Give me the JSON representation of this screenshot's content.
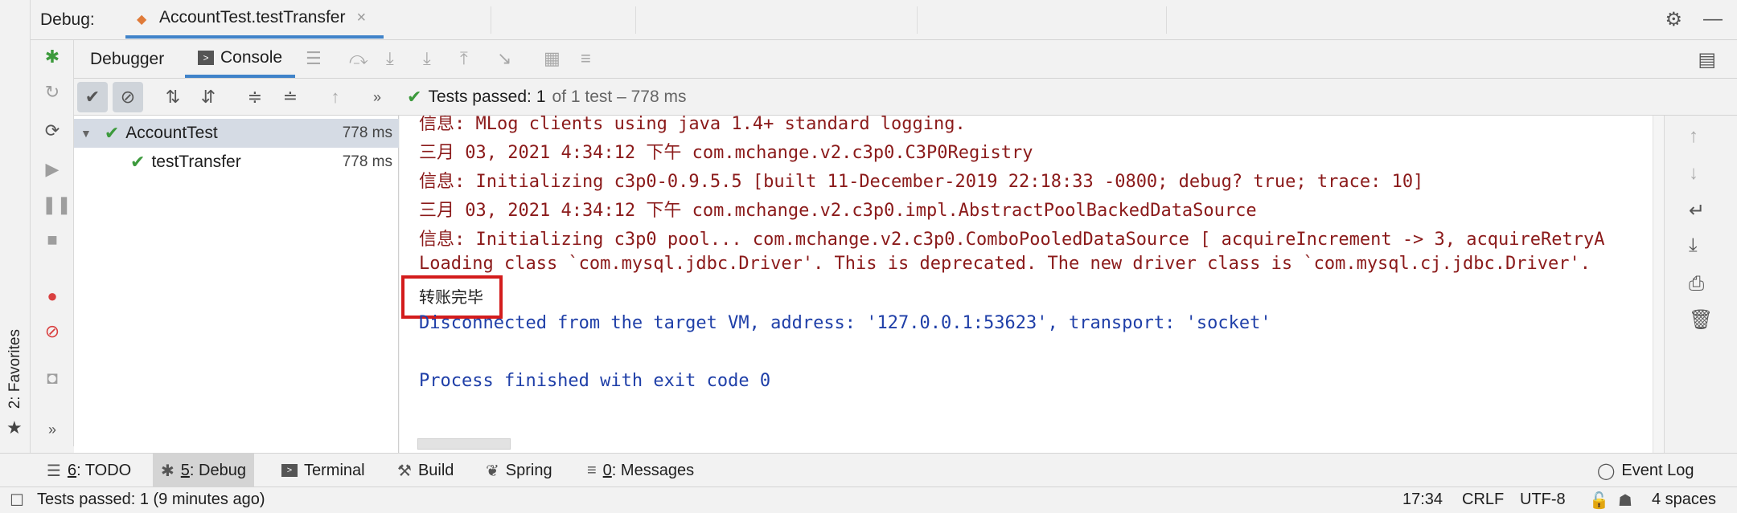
{
  "favorites": {
    "label": "2: Favorites"
  },
  "titlebar": {
    "debug_label": "Debug:",
    "tab_title": "AccountTest.testTransfer"
  },
  "subtabs": {
    "debugger": "Debugger",
    "console": "Console"
  },
  "testbar": {
    "passed_label": "Tests passed:",
    "passed_count": "1",
    "passed_detail": "of 1 test – 778 ms"
  },
  "tree": {
    "items": [
      {
        "name": "AccountTest",
        "time": "778 ms"
      },
      {
        "name": "testTransfer",
        "time": "778 ms"
      }
    ]
  },
  "console": {
    "lines": [
      "信息: MLog clients using java 1.4+ standard logging.",
      "三月 03, 2021 4:34:12 下午 com.mchange.v2.c3p0.C3P0Registry",
      "信息: Initializing c3p0-0.9.5.5 [built 11-December-2019 22:18:33 -0800; debug? true; trace: 10]",
      "三月 03, 2021 4:34:12 下午 com.mchange.v2.c3p0.impl.AbstractPoolBackedDataSource",
      "信息: Initializing c3p0 pool... com.mchange.v2.c3p0.ComboPooledDataSource [ acquireIncrement -> 3, acquireRetryA",
      "Loading class `com.mysql.jdbc.Driver'. This is deprecated. The new driver class is `com.mysql.cj.jdbc.Driver'.",
      "转账完毕",
      "Disconnected from the target VM, address: '127.0.0.1:53623', transport: 'socket'",
      "Process finished with exit code 0"
    ]
  },
  "toolwindows": {
    "todo_num": "6",
    "todo": ": TODO",
    "debug_num": "5",
    "debug": ": Debug",
    "terminal": "Terminal",
    "build": "Build",
    "spring": "Spring",
    "messages_num": "0",
    "messages": ": Messages",
    "event_log": "Event Log"
  },
  "statusbar": {
    "message": "Tests passed: 1 (9 minutes ago)",
    "position": "17:34",
    "line_sep": "CRLF",
    "encoding": "UTF-8",
    "indent": "4 spaces"
  },
  "colors": {
    "accent": "#4083c9",
    "pass": "#3c9a3c",
    "error_text": "#8b1a1a",
    "info_text": "#1f3fa8",
    "highlight": "#d31c1c"
  }
}
